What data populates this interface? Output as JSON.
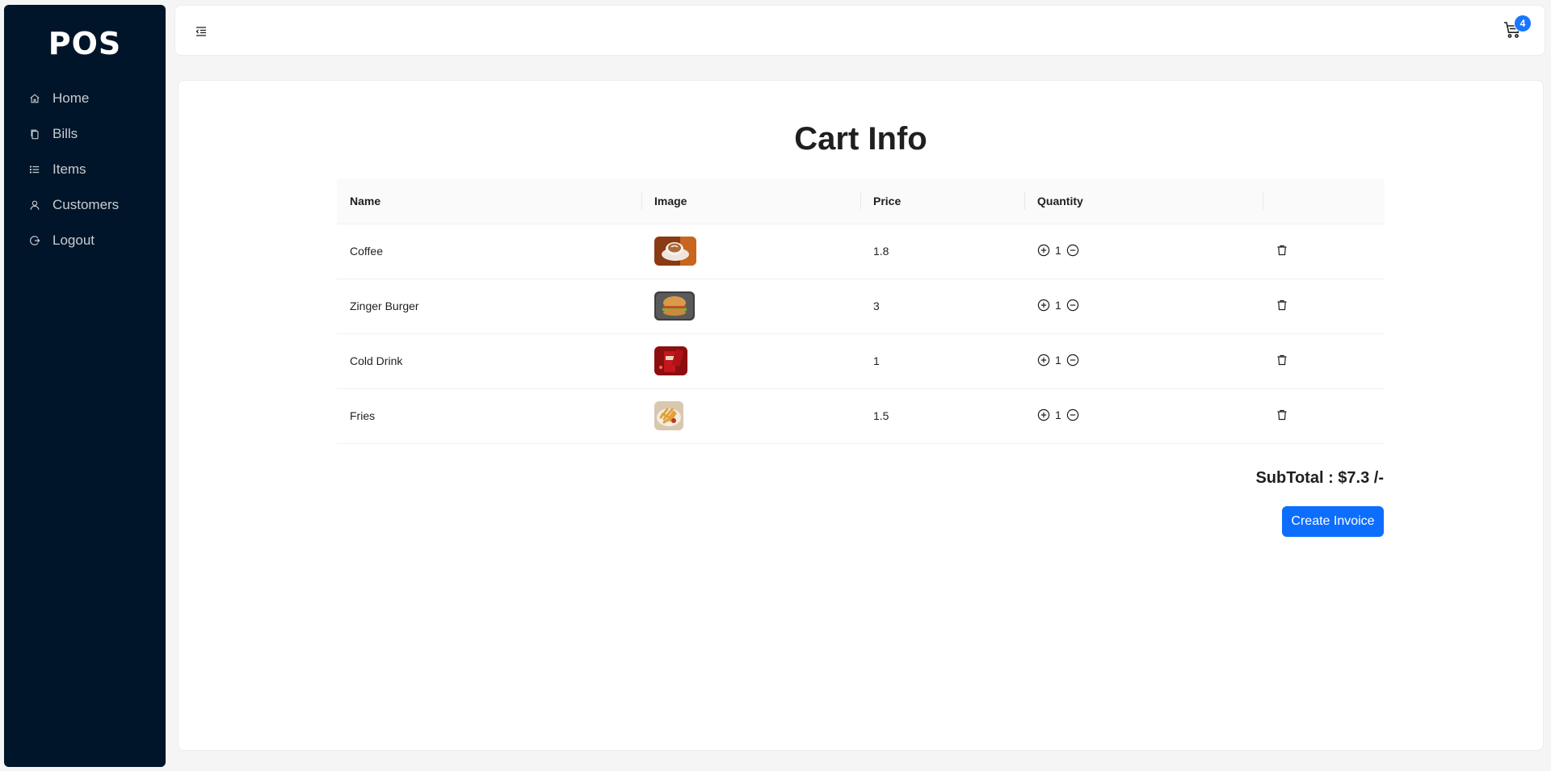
{
  "app": {
    "brand": "POS"
  },
  "sidebar": {
    "items": [
      {
        "label": "Home",
        "icon": "home-icon"
      },
      {
        "label": "Bills",
        "icon": "copy-icon"
      },
      {
        "label": "Items",
        "icon": "list-icon"
      },
      {
        "label": "Customers",
        "icon": "user-icon"
      },
      {
        "label": "Logout",
        "icon": "logout-icon"
      }
    ]
  },
  "header": {
    "cart_count": "4"
  },
  "page": {
    "title": "Cart Info"
  },
  "table": {
    "columns": [
      "Name",
      "Image",
      "Price",
      "Quantity",
      ""
    ],
    "rows": [
      {
        "name": "Coffee",
        "image": "coffee-image",
        "price": "1.8",
        "quantity": "1"
      },
      {
        "name": "Zinger Burger",
        "image": "burger-image",
        "price": "3",
        "quantity": "1"
      },
      {
        "name": "Cold Drink",
        "image": "cold-drink-image",
        "price": "1",
        "quantity": "1"
      },
      {
        "name": "Fries",
        "image": "fries-image",
        "price": "1.5",
        "quantity": "1"
      }
    ]
  },
  "summary": {
    "subtotal": "SubTotal : $7.3 /-",
    "create_invoice_label": "Create Invoice"
  },
  "colors": {
    "sidebar_bg": "#001529",
    "primary": "#0d6efd",
    "badge": "#1677ff"
  }
}
